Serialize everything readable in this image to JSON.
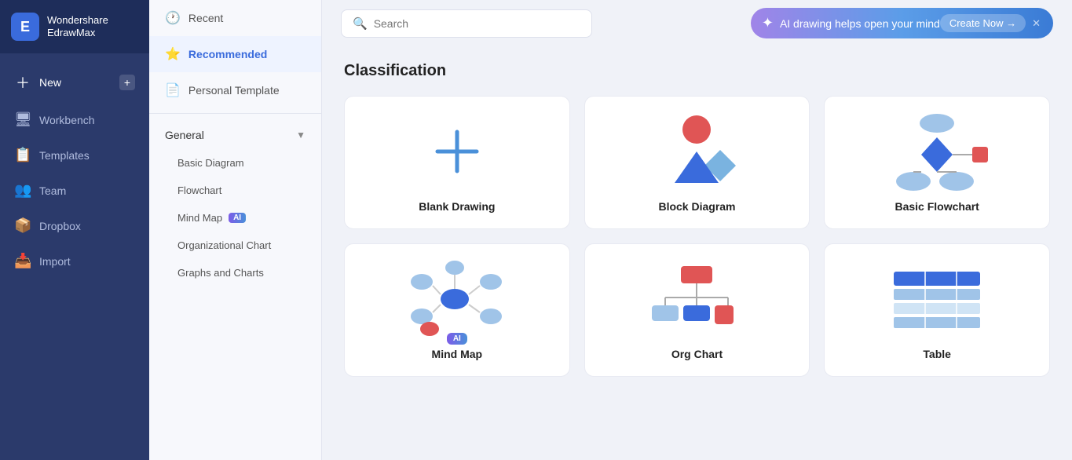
{
  "app": {
    "name": "Wondershare",
    "subname": "EdrawMax",
    "logo_letter": "E"
  },
  "sidebar": {
    "items": [
      {
        "id": "new",
        "label": "New",
        "icon": "➕",
        "has_plus": true
      },
      {
        "id": "workbench",
        "label": "Workbench",
        "icon": "🖥"
      },
      {
        "id": "templates",
        "label": "Templates",
        "icon": "📋"
      },
      {
        "id": "team",
        "label": "Team",
        "icon": "👥"
      },
      {
        "id": "dropbox",
        "label": "Dropbox",
        "icon": "📦"
      },
      {
        "id": "import",
        "label": "Import",
        "icon": "📥"
      }
    ]
  },
  "middle_panel": {
    "top_items": [
      {
        "id": "recent",
        "label": "Recent",
        "icon": "🕐",
        "active": false
      },
      {
        "id": "recommended",
        "label": "Recommended",
        "icon": "⭐",
        "active": true
      }
    ],
    "personal": {
      "label": "Personal Template",
      "icon": "📄"
    },
    "general_section": {
      "label": "General",
      "items": [
        {
          "id": "basic-diagram",
          "label": "Basic Diagram",
          "has_ai": false
        },
        {
          "id": "flowchart",
          "label": "Flowchart",
          "has_ai": false
        },
        {
          "id": "mind-map",
          "label": "Mind Map",
          "has_ai": true
        },
        {
          "id": "org-chart",
          "label": "Organizational Chart",
          "has_ai": false
        },
        {
          "id": "graphs",
          "label": "Graphs and Charts",
          "has_ai": false
        }
      ]
    }
  },
  "header": {
    "search_placeholder": "Search",
    "ai_banner_text": "AI drawing helps open your mind",
    "ai_banner_btn": "Create Now →"
  },
  "main": {
    "section_title": "Classification",
    "cards": [
      {
        "id": "blank-drawing",
        "label": "Blank Drawing",
        "type": "blank",
        "has_ai": false
      },
      {
        "id": "block-diagram",
        "label": "Block Diagram",
        "type": "block",
        "has_ai": false
      },
      {
        "id": "basic-flowchart",
        "label": "Basic Flowchart",
        "type": "flowchart",
        "has_ai": false
      },
      {
        "id": "mind-map-card",
        "label": "Mind Map",
        "type": "mindmap",
        "has_ai": true
      },
      {
        "id": "org-chart-card",
        "label": "Org Chart",
        "type": "orgchart",
        "has_ai": false
      },
      {
        "id": "table-card",
        "label": "Table",
        "type": "table",
        "has_ai": false
      }
    ]
  }
}
